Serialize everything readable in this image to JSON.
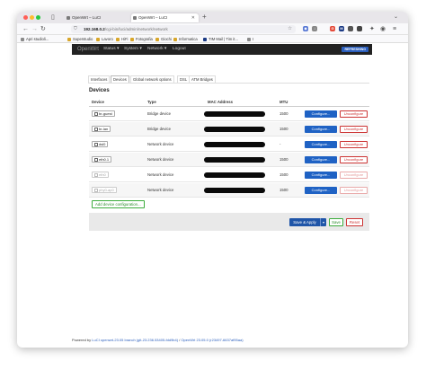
{
  "browser": {
    "tabs": [
      {
        "label": "OpenWrt – LuCI",
        "active": false
      },
      {
        "label": "OpenWrt – LuCI",
        "active": true
      }
    ],
    "url_host": "192.168.0.2",
    "url_path": "/cgi-bin/luci/admin/network/network",
    "bookmarks": [
      "Apri studioli...",
      "Superstudio",
      "Lavoro",
      "HiFi",
      "Fotografia",
      "Giochi",
      "Informatica",
      "TIM Mail | Tim it...",
      "I"
    ],
    "extensions": [
      {
        "label": "G",
        "color": "#e44b3b"
      },
      {
        "label": "M",
        "color": "#1b3a84"
      },
      {
        "label": "",
        "color": "#555555"
      },
      {
        "label": "",
        "color": "#444444"
      }
    ]
  },
  "luci": {
    "brand": "OpenWrt",
    "menu": [
      "Status",
      "System",
      "Network",
      "Logout"
    ],
    "refresh_label": "REFRESHING"
  },
  "subtabs": [
    "Interfaces",
    "Devices",
    "Global network options",
    "DSL",
    "ATM Bridges"
  ],
  "section_title": "Devices",
  "table": {
    "headers": [
      "Device",
      "Type",
      "MAC Address",
      "MTU"
    ],
    "rows": [
      {
        "device": "br-guest",
        "type": "Bridge device",
        "mtu": "1500",
        "dim": false
      },
      {
        "device": "br-lan",
        "type": "Bridge device",
        "mtu": "1500",
        "dim": false
      },
      {
        "device": "dsl0",
        "type": "Network device",
        "mtu": "-",
        "dim": false
      },
      {
        "device": "eth0.1",
        "type": "Network device",
        "mtu": "1500",
        "dim": false
      },
      {
        "device": "eth0",
        "type": "Network device",
        "mtu": "1500",
        "dim": true
      },
      {
        "device": "phy0-ap0",
        "type": "Network device",
        "mtu": "1500",
        "dim": true
      }
    ],
    "configure_label": "Configure...",
    "unconfigure_label": "Unconfigure"
  },
  "add_button_label": "Add device configuration...",
  "actions": {
    "save_apply": "Save & Apply",
    "dropdown": "▾",
    "save": "Save",
    "reset": "Reset"
  },
  "footer": {
    "prefix": "Powered by",
    "luci_link": "LuCI openwrt-23.05 branch (git-23.236.53405-fdd9b4)",
    "separator": " / ",
    "openwrt_link": "OpenWrt 23.05.0 (r23497-6637af95aa)"
  }
}
